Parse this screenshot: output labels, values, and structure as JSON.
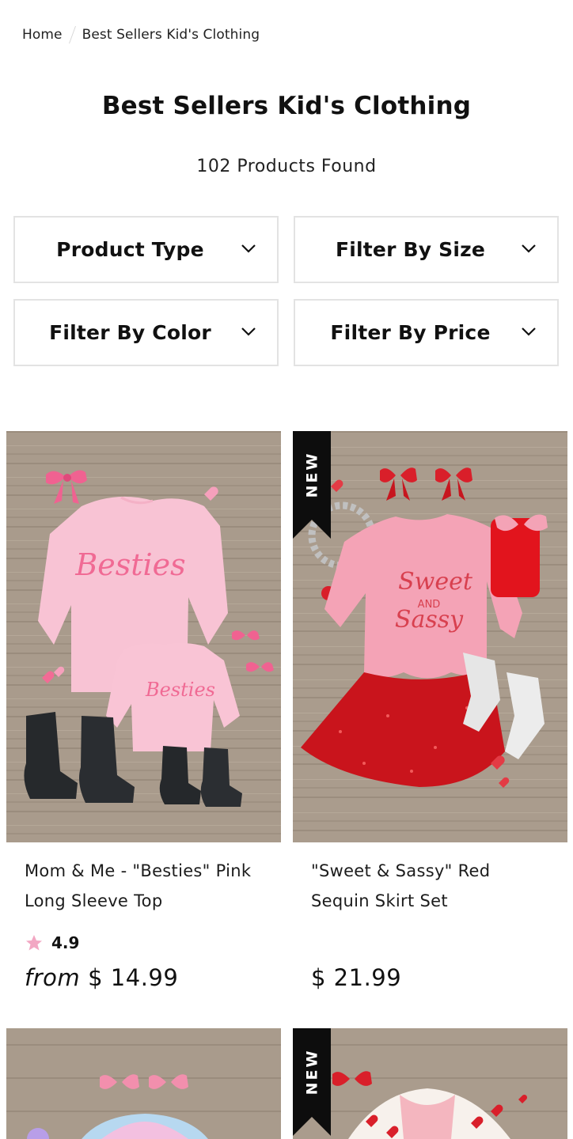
{
  "breadcrumb": {
    "home": "Home",
    "current": "Best Sellers Kid's Clothing"
  },
  "page": {
    "title": "Best Sellers Kid's Clothing",
    "count": "102 Products Found"
  },
  "filters": [
    {
      "label": "Product Type"
    },
    {
      "label": "Filter By Size"
    },
    {
      "label": "Filter By Color"
    },
    {
      "label": "Filter By Price"
    }
  ],
  "products": [
    {
      "name_line1": "Mom & Me - \"Besties\" Pink",
      "name_line2": "Long Sleeve Top",
      "rating": "4.9",
      "price_prefix": "from",
      "price": "$ 14.99",
      "badge": "",
      "shirt_text": "Besties"
    },
    {
      "name_line1": "\"Sweet & Sassy\" Red",
      "name_line2": "Sequin Skirt Set",
      "price": "$ 21.99",
      "badge": "NEW",
      "shirt_text_1": "Sweet",
      "shirt_text_2": "AND",
      "shirt_text_3": "Sassy"
    },
    {
      "badge": ""
    },
    {
      "badge": "NEW"
    }
  ],
  "colors": {
    "star": "#f2a7c3",
    "badge_bg": "#0d0d0d",
    "border": "#e3e3e3"
  },
  "icons": {
    "filter_chevron": "chevron-down-icon",
    "rating_star": "star-icon"
  }
}
